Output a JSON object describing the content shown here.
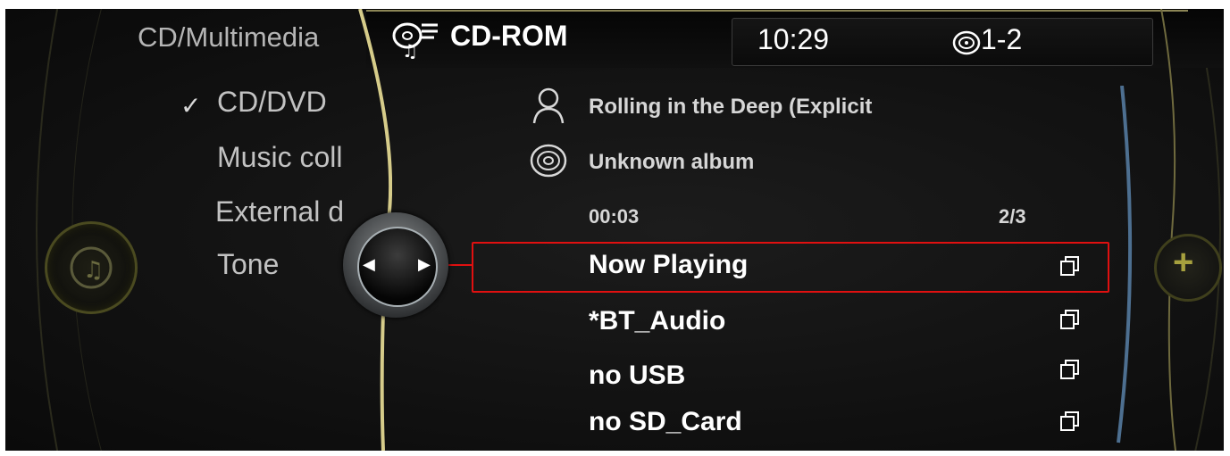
{
  "left_menu": {
    "title": "CD/Multimedia",
    "checked_mark": "✓",
    "items": [
      {
        "label": "CD/DVD"
      },
      {
        "label": "Music coll"
      },
      {
        "label": "External d"
      },
      {
        "label": "Tone"
      }
    ]
  },
  "header": {
    "source_title": "CD-ROM",
    "clock": "10:29",
    "disc_slot": "1-2"
  },
  "now_playing_info": {
    "track": "Rolling in the Deep (Explicit",
    "album": "Unknown album",
    "elapsed": "00:03",
    "track_position": "2/3"
  },
  "sources": [
    {
      "label": "Now Playing"
    },
    {
      "label": "*BT_Audio"
    },
    {
      "label": "no USB"
    },
    {
      "label": "no SD_Card"
    }
  ],
  "controller": {
    "left_arrow": "◀",
    "right_arrow": "▶"
  },
  "side_button": {
    "plus": "+"
  },
  "colors": {
    "highlight": "#e01010",
    "accent_gold": "#d6cc8a",
    "scroll_blue": "#4d6f90"
  }
}
